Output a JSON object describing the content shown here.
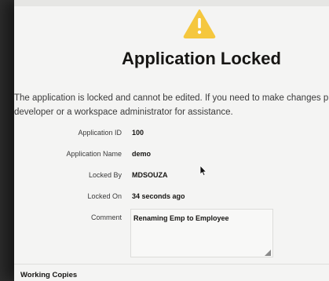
{
  "dialog": {
    "title": "Application Locked",
    "icon": "warning-icon",
    "icon_color": "#f5c73e",
    "message": "The application is locked and cannot be edited. If you need to make changes plea the developer or a workspace administrator for assistance."
  },
  "fields": {
    "application_id": {
      "label": "Application ID",
      "value": "100"
    },
    "application_name": {
      "label": "Application Name",
      "value": "demo"
    },
    "locked_by": {
      "label": "Locked By",
      "value": "MDSOUZA"
    },
    "locked_on": {
      "label": "Locked On",
      "value": "34 seconds ago"
    },
    "comment": {
      "label": "Comment",
      "value": "Renaming Emp to Employee"
    }
  },
  "working_copies": {
    "header": "Working Copies"
  }
}
